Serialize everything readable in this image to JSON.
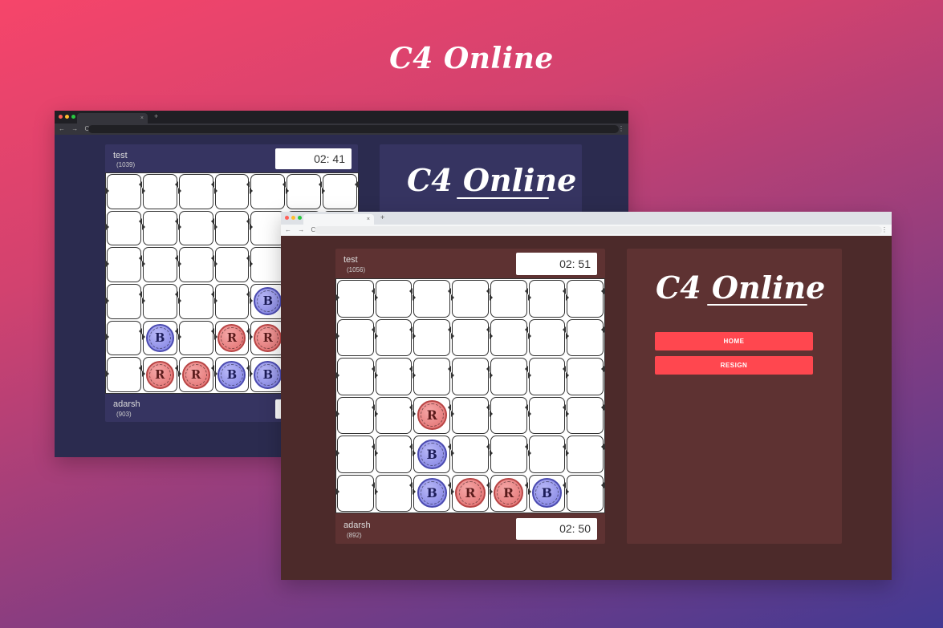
{
  "hero": {
    "title": "C4 Online"
  },
  "back_window": {
    "tab_close": "×",
    "tab_new": "+",
    "nav_icons": "← → C",
    "menu_icon": "⋮",
    "top_player": {
      "name": "test",
      "rating": "(1039)",
      "timer": "02: 41"
    },
    "bottom_player": {
      "name": "adarsh",
      "rating": "(903)"
    },
    "logo": "C4 Online",
    "grid": [
      [
        "",
        "",
        "",
        "",
        "",
        "",
        ""
      ],
      [
        "",
        "",
        "",
        "",
        "",
        "",
        ""
      ],
      [
        "",
        "",
        "",
        "",
        "",
        "",
        ""
      ],
      [
        "",
        "",
        "",
        "",
        "B",
        "",
        ""
      ],
      [
        "",
        "B",
        "",
        "R",
        "R",
        "",
        ""
      ],
      [
        "",
        "R",
        "R",
        "B",
        "B",
        "",
        ""
      ]
    ]
  },
  "front_window": {
    "tab_close": "×",
    "tab_new": "+",
    "nav_icons": "← → C",
    "menu_icon": "⋮",
    "top_player": {
      "name": "test",
      "rating": "(1056)",
      "timer": "02: 51"
    },
    "bottom_player": {
      "name": "adarsh",
      "rating": "(892)",
      "timer": "02: 50"
    },
    "logo": "C4 Online",
    "buttons": {
      "home": "HOME",
      "resign": "RESIGN"
    },
    "grid": [
      [
        "",
        "",
        "",
        "",
        "",
        "",
        ""
      ],
      [
        "",
        "",
        "",
        "",
        "",
        "",
        ""
      ],
      [
        "",
        "",
        "",
        "",
        "",
        "",
        ""
      ],
      [
        "",
        "",
        "R",
        "",
        "",
        "",
        ""
      ],
      [
        "",
        "",
        "B",
        "",
        "",
        "",
        ""
      ],
      [
        "",
        "",
        "B",
        "R",
        "R",
        "B",
        ""
      ]
    ]
  },
  "colors": {
    "back_bg": "#2b2b4f",
    "back_panel": "#363461",
    "front_bg": "#4c2a2a",
    "front_panel": "#5e3232",
    "button": "#ff474f"
  }
}
